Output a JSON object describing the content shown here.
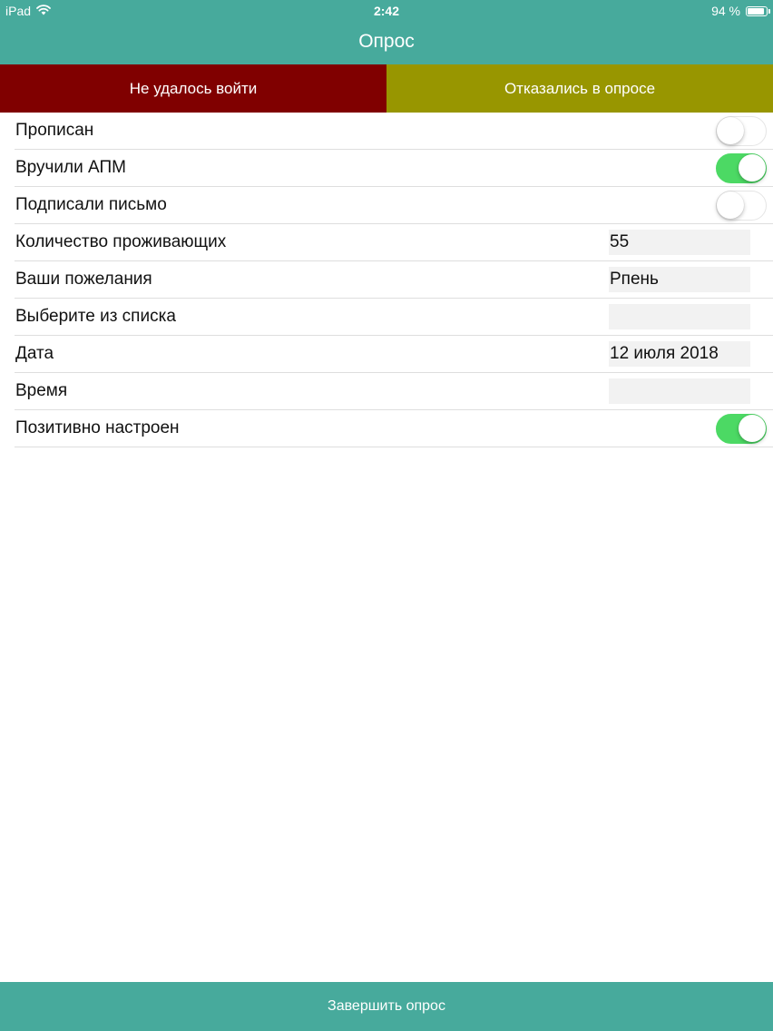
{
  "status_bar": {
    "device": "iPad",
    "time": "2:42",
    "battery_text": "94 %",
    "battery_level": 0.94,
    "wifi_icon": "wifi-icon",
    "battery_icon": "battery-icon"
  },
  "header": {
    "title": "Опрос",
    "background_color": "#47aa9c"
  },
  "segments": {
    "left_label": "Не удалось войти",
    "left_color": "#800000",
    "right_label": "Отказались в опросе",
    "right_color": "#989600"
  },
  "form": {
    "rows": [
      {
        "label": "Прописан",
        "type": "toggle",
        "on": false
      },
      {
        "label": "Вручили АПМ",
        "type": "toggle",
        "on": true
      },
      {
        "label": "Подписали письмо",
        "type": "toggle",
        "on": false
      },
      {
        "label": "Количество проживающих",
        "type": "field",
        "value": "55"
      },
      {
        "label": "Ваши пожелания",
        "type": "field",
        "value": "Рпень"
      },
      {
        "label": "Выберите из списка",
        "type": "field",
        "value": ""
      },
      {
        "label": "Дата",
        "type": "field",
        "value": "12 июля 2018"
      },
      {
        "label": "Время",
        "type": "field",
        "value": ""
      },
      {
        "label": "Позитивно настроен",
        "type": "toggle",
        "on": true
      }
    ],
    "toggle_on_color": "#4cd964"
  },
  "footer": {
    "finish_label": "Завершить опрос"
  }
}
